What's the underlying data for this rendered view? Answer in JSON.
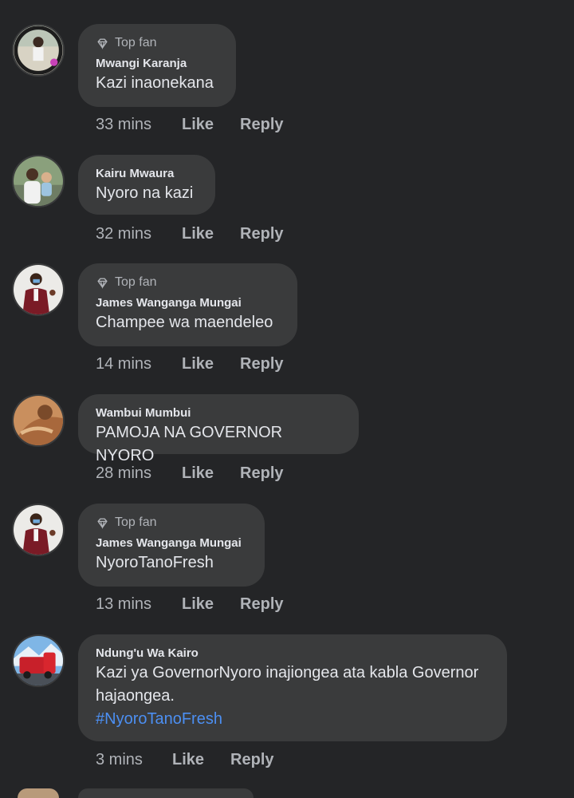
{
  "comments": [
    {
      "badge": "Top fan",
      "author": "Mwangi Karanja",
      "text": "Kazi inaonekana",
      "time": "33 mins",
      "like": "Like",
      "reply": "Reply",
      "avatar": "avatar-person-outdoors"
    },
    {
      "author": "Kairu Mwaura",
      "text": "Nyoro na kazi",
      "time": "32 mins",
      "like": "Like",
      "reply": "Reply",
      "avatar": "avatar-man-with-child"
    },
    {
      "badge": "Top fan",
      "author": "James Wanganga Mungai",
      "text": "Champee wa maendeleo",
      "time": "14 mins",
      "like": "Like",
      "reply": "Reply",
      "avatar": "avatar-man-maroon-jacket"
    },
    {
      "author": "Wambui Mumbui",
      "text": "PAMOJA NA GOVERNOR NYORO",
      "time": "28 mins",
      "like": "Like",
      "reply": "Reply",
      "avatar": "avatar-woman-portrait"
    },
    {
      "badge": "Top fan",
      "author": "James Wanganga Mungai",
      "text": "NyoroTanoFresh",
      "time": "13 mins",
      "like": "Like",
      "reply": "Reply",
      "avatar": "avatar-man-maroon-jacket"
    },
    {
      "author": "Ndung'u Wa Kairo",
      "text_line1": "Kazi ya GovernorNyoro inajiongea ata kabla Governor",
      "text_line2": "hajaongea.",
      "hashtag": "#NyoroTanoFresh",
      "time": "3 mins",
      "like": "Like",
      "reply": "Reply",
      "avatar": "avatar-red-truck"
    }
  ],
  "colors": {
    "background": "#242527",
    "bubble": "#3a3b3c",
    "primary_text": "#e4e6eb",
    "secondary_text": "#b0b3b8",
    "link": "#4c8ff2"
  }
}
